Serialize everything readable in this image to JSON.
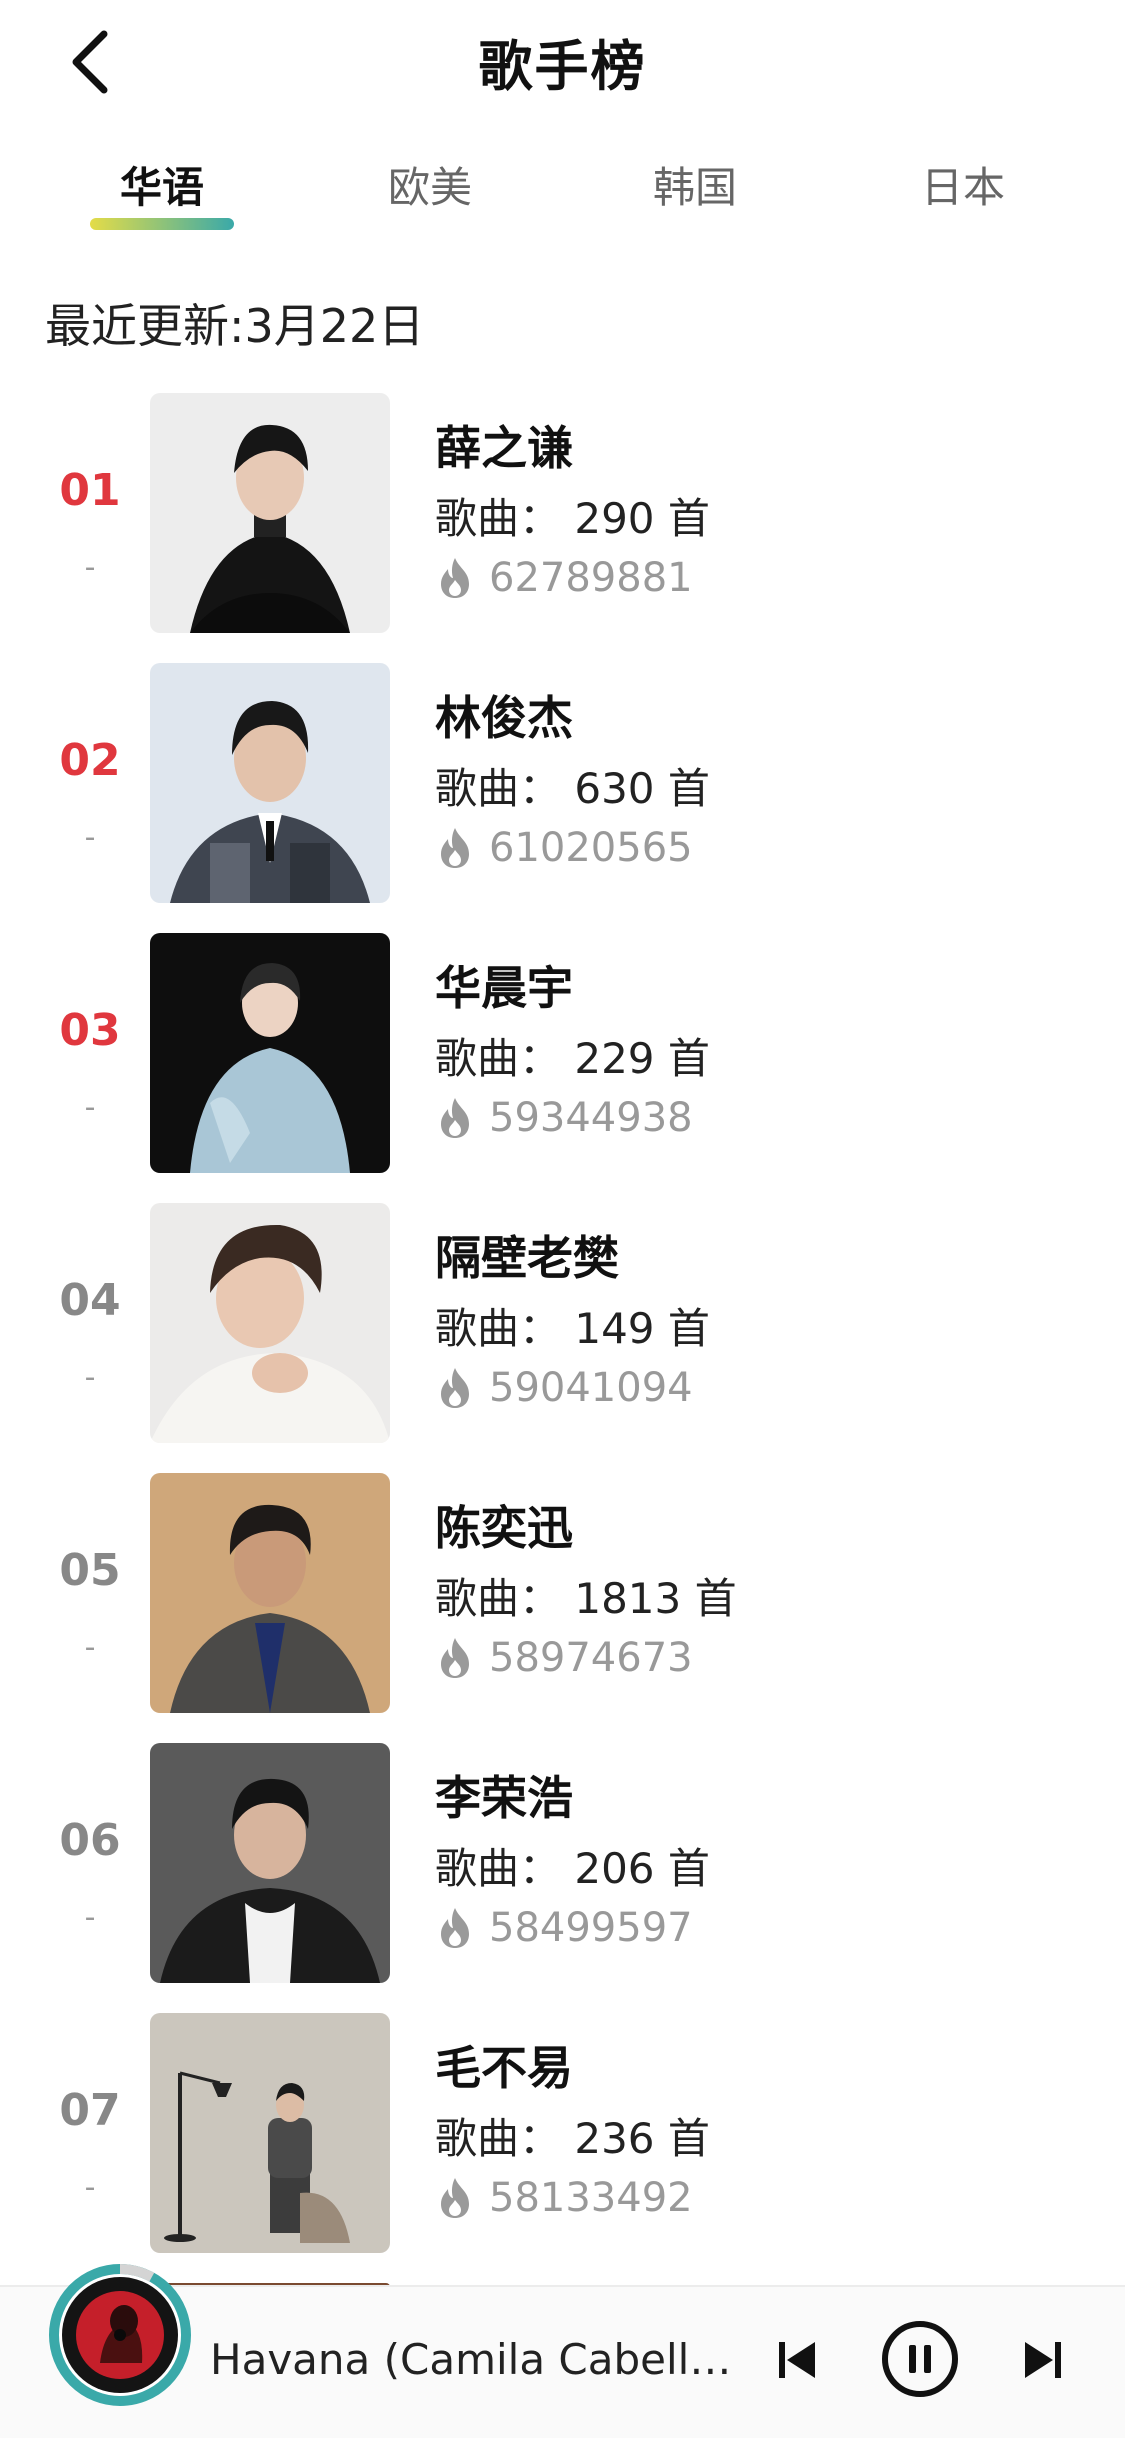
{
  "header": {
    "title": "歌手榜",
    "back_icon": "chevron-left-icon"
  },
  "tabs": [
    {
      "label": "华语",
      "active": true
    },
    {
      "label": "欧美",
      "active": false
    },
    {
      "label": "韩国",
      "active": false
    },
    {
      "label": "日本",
      "active": false
    }
  ],
  "update": {
    "text": "最近更新:3月22日"
  },
  "artists": [
    {
      "rank": "01",
      "trend": "-",
      "name": "薛之谦",
      "songs": "歌曲： 290 首",
      "heat": "62789881"
    },
    {
      "rank": "02",
      "trend": "-",
      "name": "林俊杰",
      "songs": "歌曲： 630 首",
      "heat": "61020565"
    },
    {
      "rank": "03",
      "trend": "-",
      "name": "华晨宇",
      "songs": "歌曲： 229 首",
      "heat": "59344938"
    },
    {
      "rank": "04",
      "trend": "-",
      "name": "隔壁老樊",
      "songs": "歌曲： 149 首",
      "heat": "59041094"
    },
    {
      "rank": "05",
      "trend": "-",
      "name": "陈奕迅",
      "songs": "歌曲： 1813 首",
      "heat": "58974673"
    },
    {
      "rank": "06",
      "trend": "-",
      "name": "李荣浩",
      "songs": "歌曲： 206 首",
      "heat": "58499597"
    },
    {
      "rank": "07",
      "trend": "-",
      "name": "毛不易",
      "songs": "歌曲： 236 首",
      "heat": "58133492"
    }
  ],
  "player": {
    "track": "Havana (Camila Cabello/Y…",
    "progress": 0.08,
    "icons": {
      "prev": "skip-previous-icon",
      "pause": "pause-icon",
      "next": "skip-next-icon"
    }
  },
  "colors": {
    "accent_red": "#e0373e",
    "gradient_start": "#e4dc48",
    "gradient_end": "#3aa9a9",
    "disc_ring": "#3aa9a9"
  }
}
